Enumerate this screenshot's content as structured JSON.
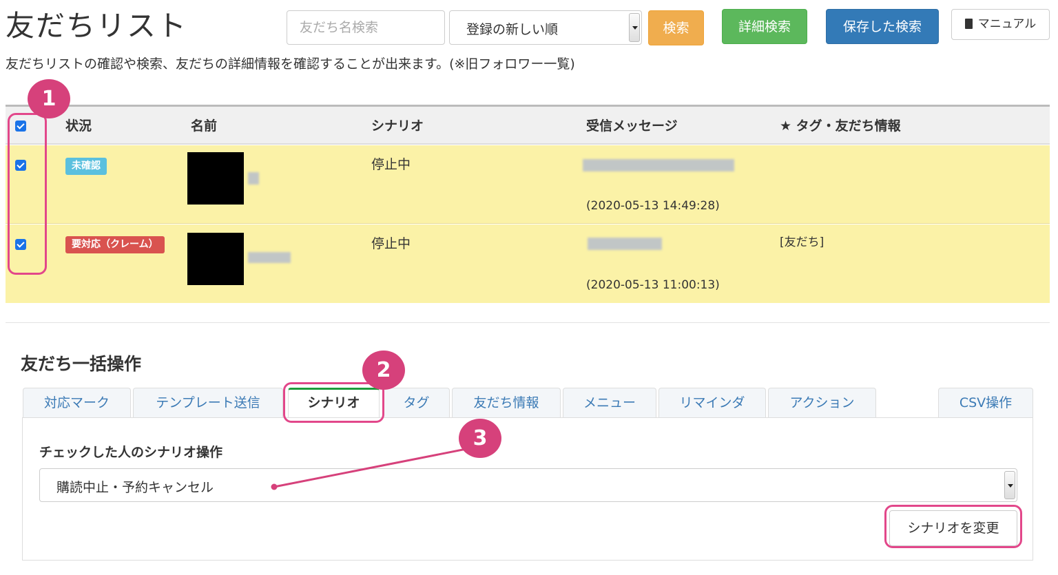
{
  "header": {
    "title": "友だちリスト",
    "subtitle": "友だちリストの確認や検索、友だちの詳細情報を確認することが出来ます。(※旧フォロワー一覧)",
    "search_placeholder": "友だち名検索",
    "sort_selected": "登録の新しい順",
    "search_label": "検索",
    "detail_search_label": "詳細検索",
    "saved_search_label": "保存した検索",
    "manual_label": "マニュアル"
  },
  "table": {
    "columns": [
      "状況",
      "名前",
      "シナリオ",
      "受信メッセージ",
      "★ タグ・友だち情報"
    ],
    "rows": [
      {
        "status": "未確認",
        "status_color": "#5bc0de",
        "scenario": "停止中",
        "timestamp": "(2020-05-13 14:49:28)",
        "tags": "",
        "checked": true
      },
      {
        "status": "要対応（クレーム）",
        "status_color": "#d9534f",
        "scenario": "停止中",
        "timestamp": "(2020-05-13 11:00:13)",
        "tags": "[友だち]",
        "checked": true
      }
    ]
  },
  "bulk": {
    "title": "友だち一括操作",
    "tabs": [
      "対応マーク",
      "テンプレート送信",
      "シナリオ",
      "タグ",
      "友だち情報",
      "メニュー",
      "リマインダ",
      "アクション",
      "CSV操作"
    ],
    "active_tab": "シナリオ",
    "panel_label": "チェックした人のシナリオ操作",
    "scenario_selected": "購読中止・予約キャンセル",
    "change_button": "シナリオを変更"
  },
  "annotations": {
    "markers": [
      "1",
      "2",
      "3"
    ],
    "color": "#d6417b"
  }
}
